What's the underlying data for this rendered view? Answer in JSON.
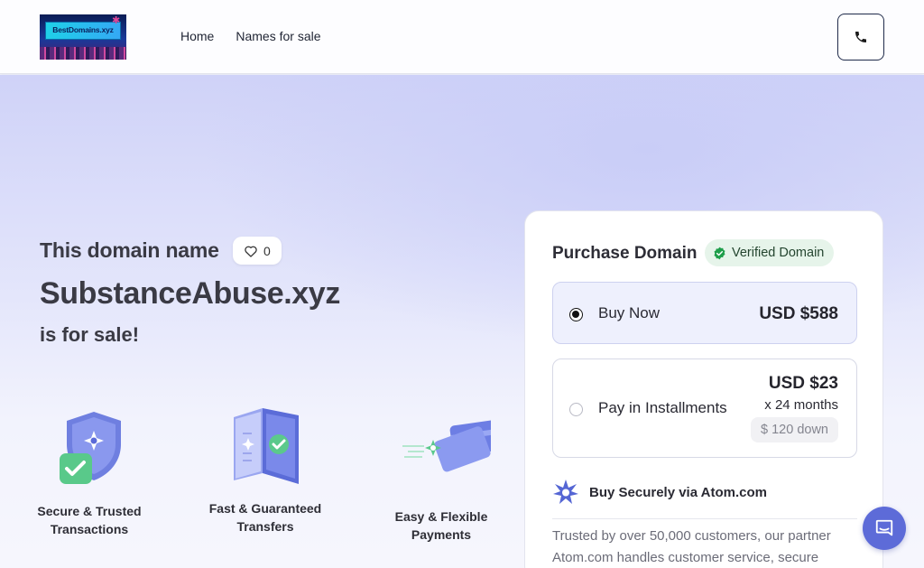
{
  "header": {
    "logo_text": "BestDomains.xyz",
    "nav": [
      {
        "label": "Home"
      },
      {
        "label": "Names for sale"
      }
    ]
  },
  "hero": {
    "prefix": "This domain name",
    "domain": "SubstanceAbuse.xyz",
    "suffix": "is for sale!",
    "like_count": "0"
  },
  "features": [
    {
      "label": "Secure & Trusted Transactions",
      "icon": "shield-check-icon"
    },
    {
      "label": "Fast & Guaranteed Transfers",
      "icon": "transfer-icon"
    },
    {
      "label": "Easy & Flexible Payments",
      "icon": "credit-card-icon"
    }
  ],
  "purchase": {
    "title": "Purchase Domain",
    "verified_label": "Verified Domain",
    "options": [
      {
        "label": "Buy Now",
        "price": "USD $588",
        "selected": true
      },
      {
        "label": "Pay in Installments",
        "price": "USD $23",
        "months": "x 24 months",
        "down": "$ 120 down",
        "selected": false
      }
    ],
    "secure_label": "Buy Securely via Atom.com",
    "trust_text": "Trusted by over 50,000 customers, our partner Atom.com handles customer service, secure"
  },
  "colors": {
    "accent": "#5d6bd8",
    "verified_green": "#1e9e4a",
    "verified_bg": "#e6f4ea"
  }
}
